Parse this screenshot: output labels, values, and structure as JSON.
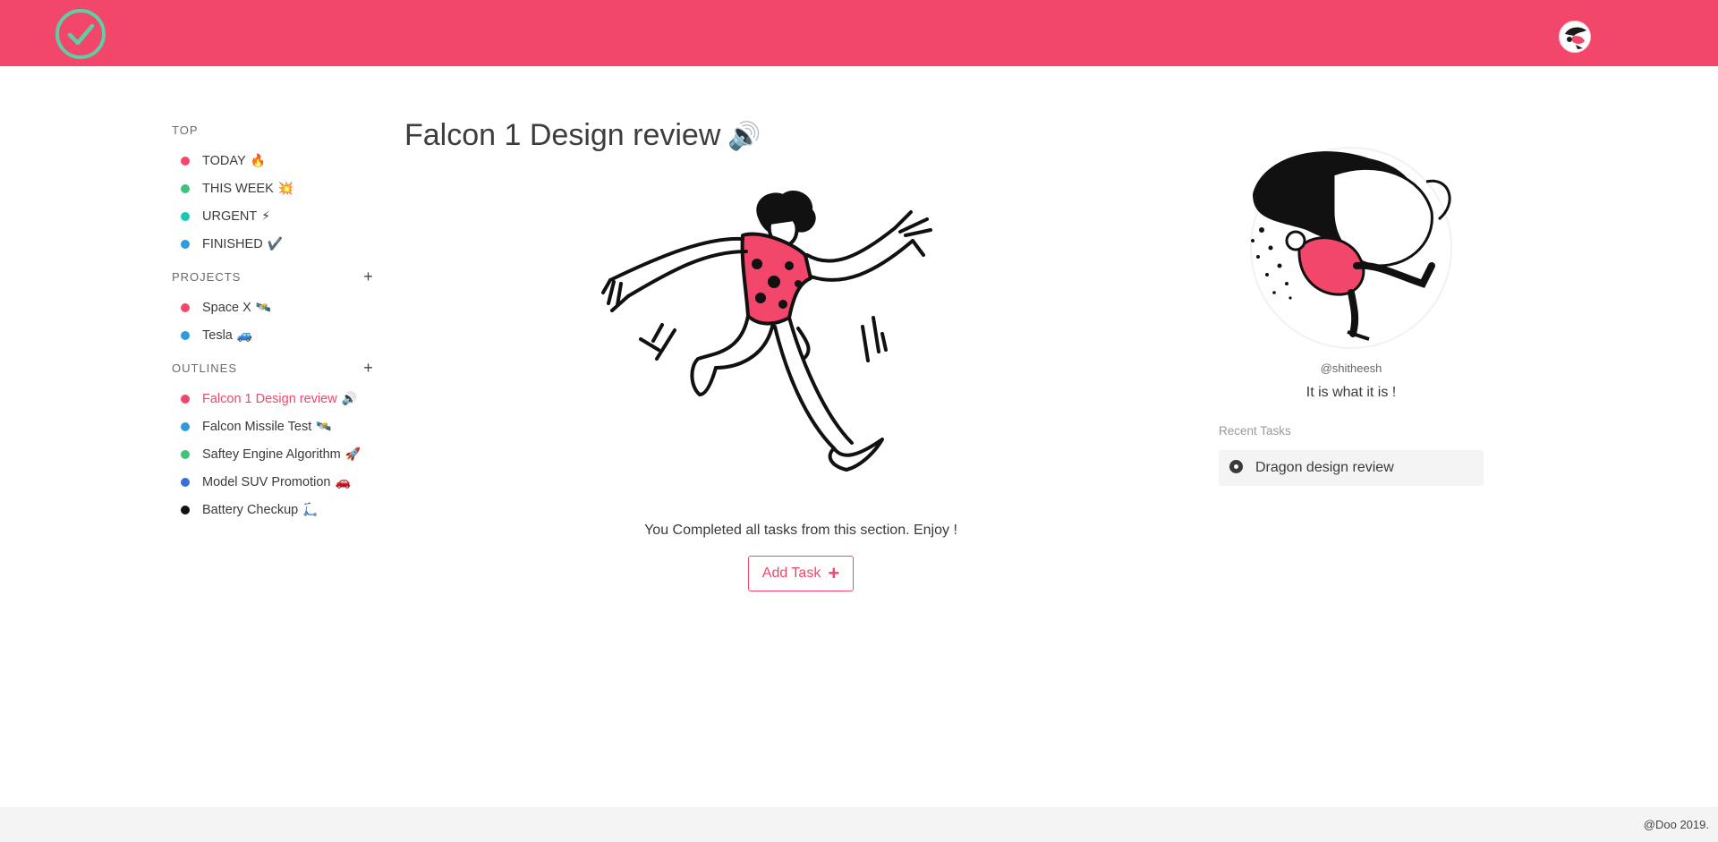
{
  "colors": {
    "brand": "#f2476a",
    "logo_ring": "#5ccfa4",
    "footer_bg": "#f4f4f4"
  },
  "header": {
    "logo_icon": "check-circle-icon",
    "avatar_icon": "user-avatar"
  },
  "sidebar": {
    "top": {
      "heading": "TOP",
      "items": [
        {
          "label": "TODAY",
          "emoji": "🔥",
          "dot": "#f2476a"
        },
        {
          "label": "THIS WEEK",
          "emoji": "💥",
          "dot": "#3ec47a"
        },
        {
          "label": "URGENT",
          "emoji": "⚡",
          "dot": "#18c9b4"
        },
        {
          "label": "FINISHED",
          "emoji": "✔️",
          "dot": "#2f9ae0"
        }
      ]
    },
    "projects": {
      "heading": "PROJECTS",
      "add_icon": "plus-icon",
      "items": [
        {
          "label": "Space X",
          "emoji": "🛰️",
          "dot": "#f2476a"
        },
        {
          "label": "Tesla",
          "emoji": "🚙",
          "dot": "#2f9ae0"
        }
      ]
    },
    "outlines": {
      "heading": "OUTLINES",
      "add_icon": "plus-icon",
      "items": [
        {
          "label": "Falcon 1 Design review",
          "emoji": "🔊",
          "dot": "#f2476a",
          "active": true
        },
        {
          "label": "Falcon Missile Test",
          "emoji": "🛰️",
          "dot": "#2f9ae0"
        },
        {
          "label": "Saftey Engine Algorithm",
          "emoji": "🚀",
          "dot": "#3ec47a"
        },
        {
          "label": "Model SUV Promotion",
          "emoji": "🚗",
          "dot": "#3b6fd8"
        },
        {
          "label": "Battery Checkup",
          "emoji": "🛴",
          "dot": "#111111"
        }
      ]
    }
  },
  "main": {
    "title": "Falcon 1 Design review",
    "title_emoji": "🔊",
    "illustration": "dancing-person-illustration",
    "empty_message": "You Completed all tasks from this section. Enjoy !",
    "add_task_label": "Add Task",
    "add_task_icon": "plus-icon"
  },
  "profile": {
    "picture": "coffee-cup-illustration",
    "username": "@shitheesh",
    "bio": "It is what it is !",
    "recent_heading": "Recent Tasks",
    "recent_tasks": [
      {
        "label": "Dragon design review"
      }
    ]
  },
  "footer": {
    "copyright": "@Doo 2019."
  }
}
